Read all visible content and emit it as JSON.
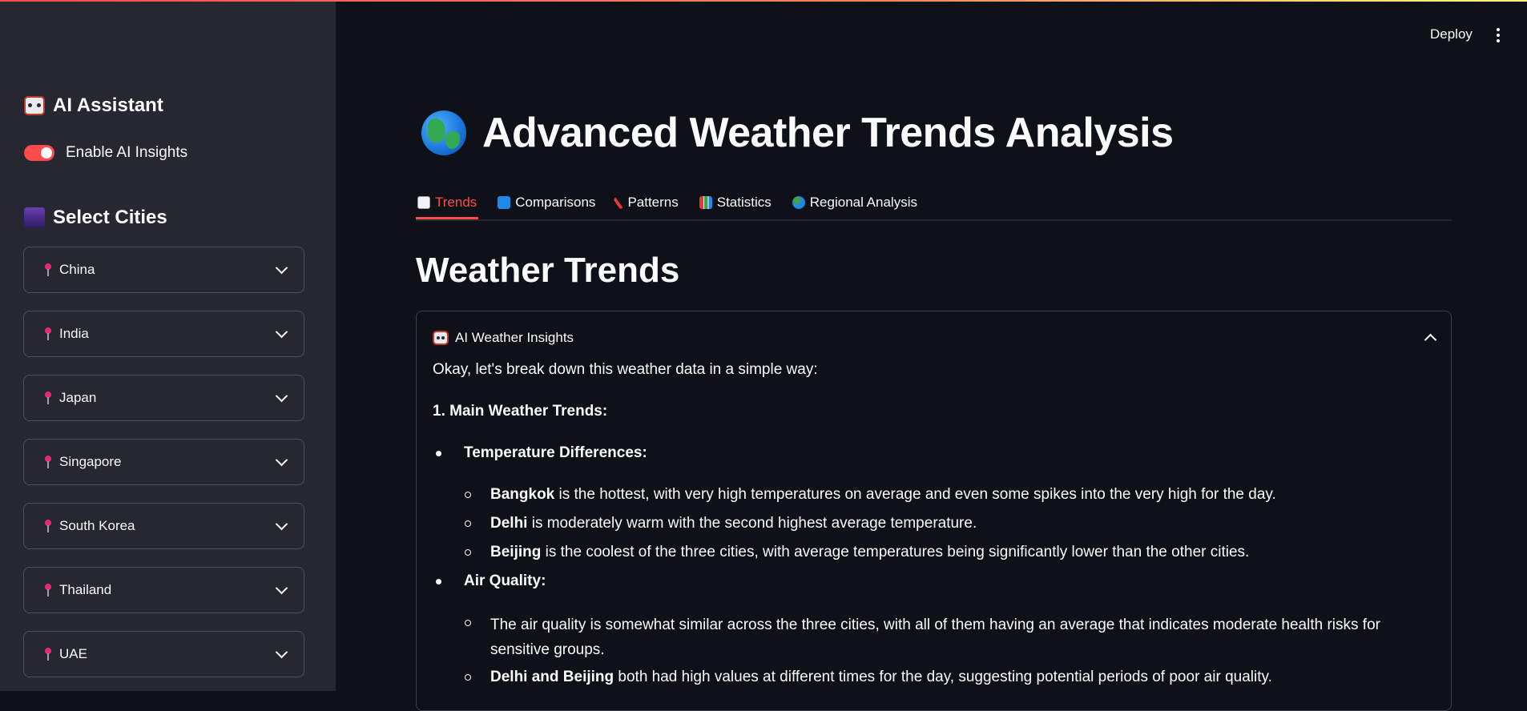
{
  "header": {
    "deploy_label": "Deploy"
  },
  "sidebar": {
    "ai_title": "AI Assistant",
    "toggle_label": "Enable AI Insights",
    "toggle_on": true,
    "cities_title": "Select Cities",
    "countries": [
      "China",
      "India",
      "Japan",
      "Singapore",
      "South Korea",
      "Thailand",
      "UAE"
    ]
  },
  "main": {
    "title": "Advanced Weather Trends Analysis",
    "tabs": [
      {
        "label": "Trends",
        "icon": "chart-increasing-icon"
      },
      {
        "label": "Comparisons",
        "icon": "arrows-cycle-icon"
      },
      {
        "label": "Patterns",
        "icon": "thermometer-icon"
      },
      {
        "label": "Statistics",
        "icon": "bar-chart-icon"
      },
      {
        "label": "Regional Analysis",
        "icon": "globe-icon"
      }
    ],
    "active_tab": "Trends",
    "section_title": "Weather Trends",
    "expander": {
      "title": "AI Weather Insights",
      "intro": "Okay, let's break down this weather data in a simple way:",
      "main_heading": "1. Main Weather Trends:",
      "temp_heading": "Temperature Differences:",
      "temp_items": [
        {
          "bold": "Bangkok",
          "text": " is the hottest, with very high temperatures on average and even some spikes into the very high for the day."
        },
        {
          "bold": "Delhi",
          "text": " is moderately warm with the second highest average temperature."
        },
        {
          "bold": "Beijing",
          "text": " is the coolest of the three cities, with average temperatures being significantly lower than the other cities."
        }
      ],
      "air_heading": "Air Quality:",
      "air_items": [
        {
          "bold": "",
          "text": "The air quality is somewhat similar across the three cities, with all of them having an average that indicates moderate health risks for sensitive groups."
        },
        {
          "bold": "Delhi and Beijing",
          "text": " both had high values at different times for the day, suggesting potential periods of poor air quality."
        }
      ]
    }
  },
  "colors": {
    "accent": "#ff4b4b",
    "sidebar_bg": "#262730",
    "main_bg": "#0e1117"
  }
}
